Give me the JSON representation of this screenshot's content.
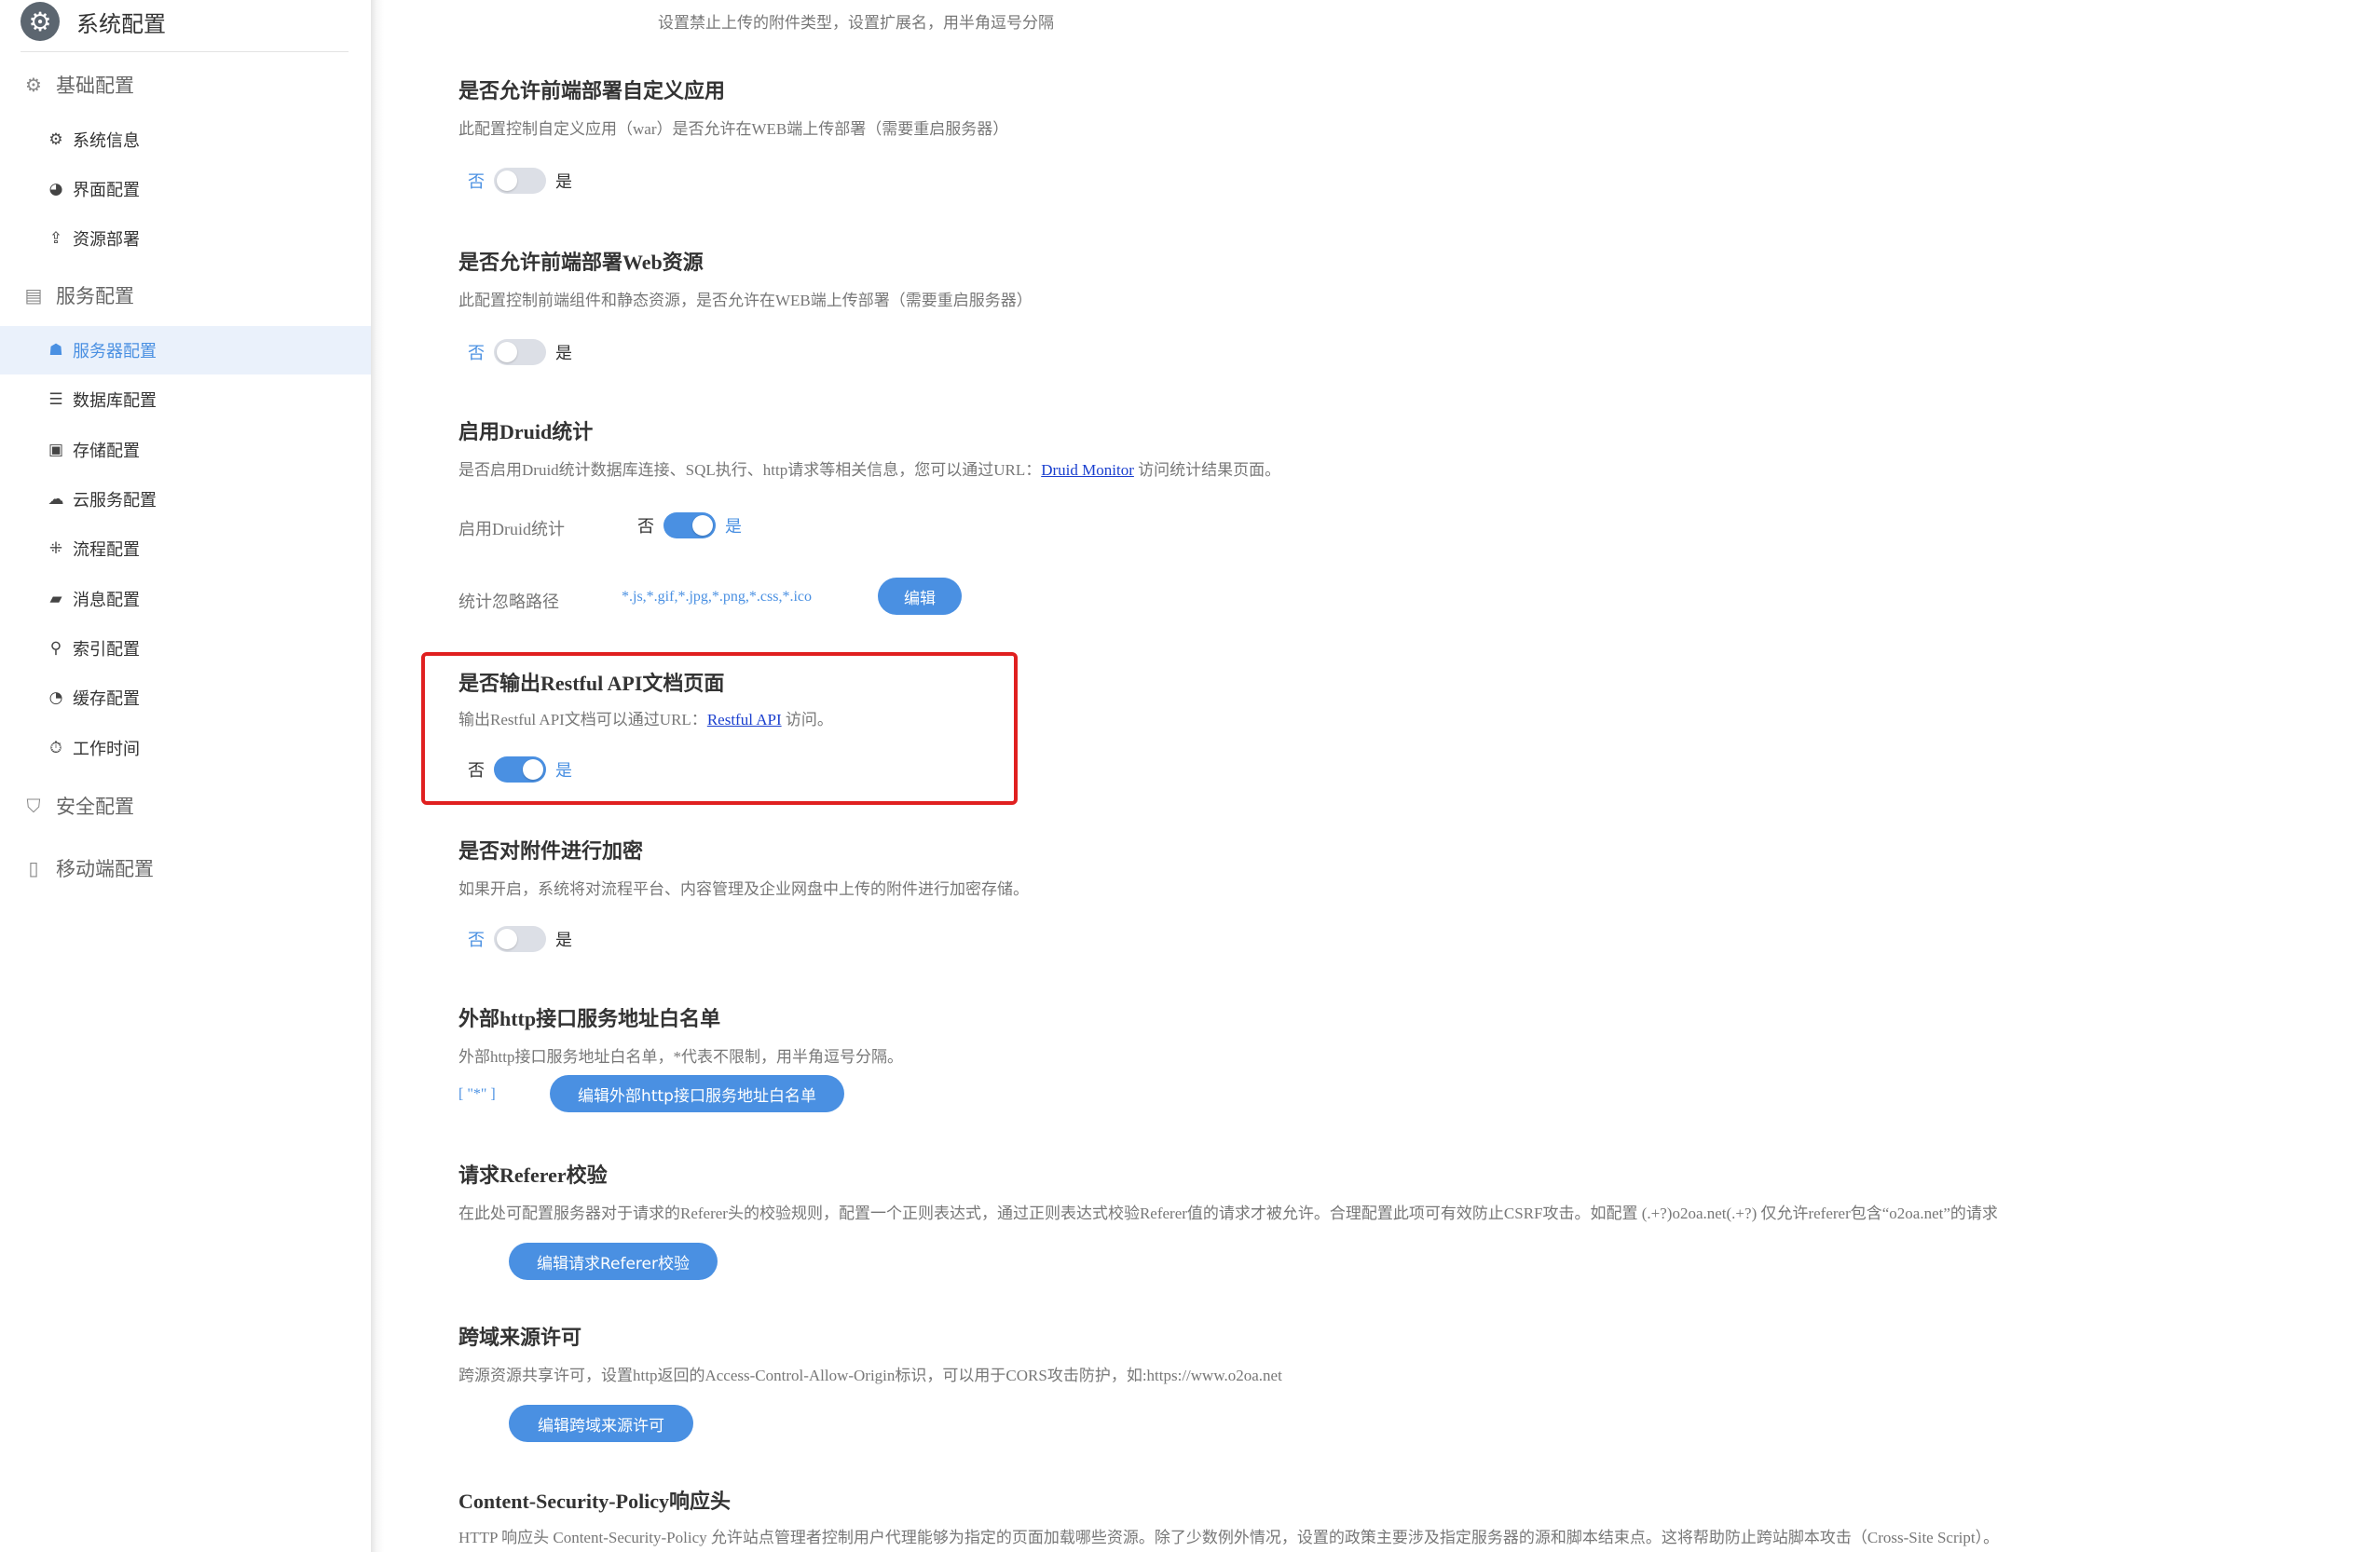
{
  "sidebar": {
    "title": "系统配置",
    "groups": [
      {
        "label": "基础配置",
        "icon": "gear-icon"
      },
      {
        "label": "服务配置",
        "icon": "server-icon"
      },
      {
        "label": "安全配置",
        "icon": "shield-icon"
      },
      {
        "label": "移动端配置",
        "icon": "mobile-icon"
      }
    ],
    "items": [
      {
        "label": "系统信息",
        "icon": "gear-icon"
      },
      {
        "label": "界面配置",
        "icon": "palette-icon"
      },
      {
        "label": "资源部署",
        "icon": "upload-icon"
      },
      {
        "label": "服务器配置",
        "icon": "server-icon",
        "active": true
      },
      {
        "label": "数据库配置",
        "icon": "database-icon"
      },
      {
        "label": "存储配置",
        "icon": "storage-icon"
      },
      {
        "label": "云服务配置",
        "icon": "cloud-icon"
      },
      {
        "label": "流程配置",
        "icon": "flow-icon"
      },
      {
        "label": "消息配置",
        "icon": "message-icon"
      },
      {
        "label": "索引配置",
        "icon": "search-icon"
      },
      {
        "label": "缓存配置",
        "icon": "pie-icon"
      },
      {
        "label": "工作时间",
        "icon": "timer-icon"
      }
    ]
  },
  "top_desc": "设置禁止上传的附件类型，设置扩展名，用半角逗号分隔",
  "sections": {
    "custom_app": {
      "title": "是否允许前端部署自定义应用",
      "desc": "此配置控制自定义应用（war）是否允许在WEB端上传部署（需要重启服务器）",
      "no": "否",
      "yes": "是",
      "value": false
    },
    "web_resource": {
      "title": "是否允许前端部署Web资源",
      "desc": "此配置控制前端组件和静态资源，是否允许在WEB端上传部署（需要重启服务器）",
      "no": "否",
      "yes": "是",
      "value": false
    },
    "druid": {
      "title": "启用Druid统计",
      "desc_pre": "是否启用Druid统计数据库连接、SQL执行、http请求等相关信息，您可以通过URL：",
      "desc_link": "Druid Monitor",
      "desc_post": " 访问统计结果页面。",
      "toggle_label": "启用Druid统计",
      "no": "否",
      "yes": "是",
      "value": true,
      "ignore_label": "统计忽略路径",
      "ignore_value": "*.js,*.gif,*.jpg,*.png,*.css,*.ico",
      "edit_button": "编辑"
    },
    "restful": {
      "title": "是否输出Restful API文档页面",
      "desc_pre": "输出Restful API文档可以通过URL：",
      "desc_link": "Restful API",
      "desc_post": " 访问。",
      "no": "否",
      "yes": "是",
      "value": true
    },
    "encrypt": {
      "title": "是否对附件进行加密",
      "desc": "如果开启，系统将对流程平台、内容管理及企业网盘中上传的附件进行加密存储。",
      "no": "否",
      "yes": "是",
      "value": false
    },
    "whitelist": {
      "title": "外部http接口服务地址白名单",
      "desc": "外部http接口服务地址白名单，*代表不限制，用半角逗号分隔。",
      "value": "[ \"*\" ]",
      "button": "编辑外部http接口服务地址白名单"
    },
    "referer": {
      "title": "请求Referer校验",
      "desc": "在此处可配置服务器对于请求的Referer头的校验规则，配置一个正则表达式，通过正则表达式校验Referer值的请求才被允许。合理配置此项可有效防止CSRF攻击。如配置 (.+?)o2oa.net(.+?) 仅允许referer包含“o2oa.net”的请求",
      "button": "编辑请求Referer校验"
    },
    "cors": {
      "title": "跨域来源许可",
      "desc": "跨源资源共享许可，设置http返回的Access-Control-Allow-Origin标识，可以用于CORS攻击防护，如:https://www.o2oa.net",
      "button": "编辑跨域来源许可"
    },
    "csp": {
      "title": "Content-Security-Policy响应头",
      "desc": "HTTP 响应头 Content-Security-Policy 允许站点管理者控制用户代理能够为指定的页面加载哪些资源。除了少数例外情况，设置的政策主要涉及指定服务器的源和脚本结束点。这将帮助防止跨站脚本攻击（Cross-Site Script）。"
    }
  },
  "colors": {
    "accent": "#4a90e2",
    "highlight": "#e02020",
    "active_bg": "#eaf1fb"
  }
}
